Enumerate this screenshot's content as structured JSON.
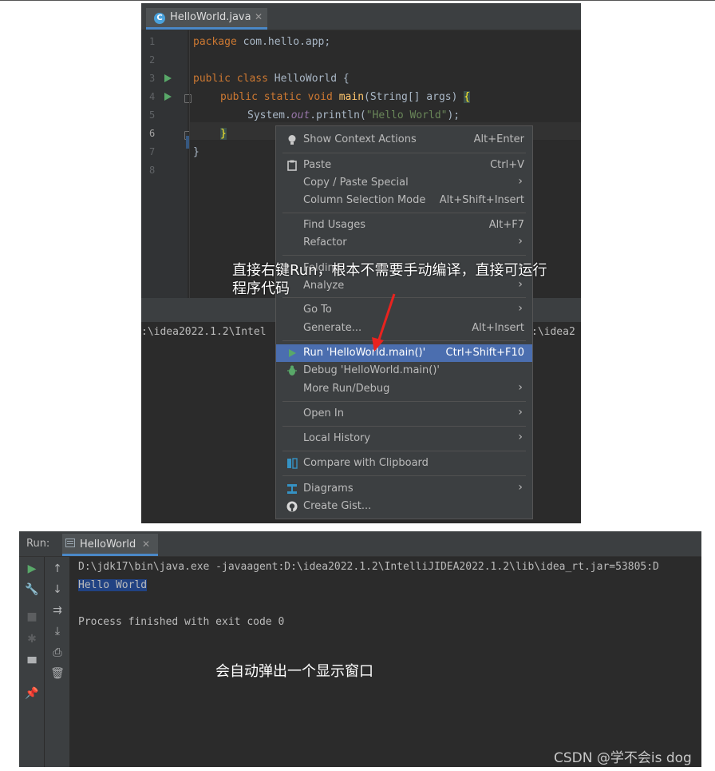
{
  "editor": {
    "tab_title": "HelloWorld.java",
    "tab_icon": "java-class-icon",
    "line_numbers": [
      "1",
      "2",
      "3",
      "4",
      "5",
      "6",
      "7",
      "8"
    ],
    "code": {
      "l1_kw": "package",
      "l1_rest": " com.hello.app;",
      "l3_kw": "public class",
      "l3_rest": " HelloWorld {",
      "l4_kw": "public static void",
      "l4_fn": "main",
      "l4_rest": "(String[] args) ",
      "l4_brace": "{",
      "l5_a": "System.",
      "l5_out": "out",
      "l5_b": ".println(",
      "l5_str": "\"Hello World\"",
      "l5_c": ");",
      "l6_brace": "}",
      "l7": "}"
    },
    "console_fragment_left": ":\\idea2022.1.2\\Intel",
    "console_fragment_right": ":\\idea2"
  },
  "context_menu": {
    "items": [
      {
        "label": "Show Context Actions",
        "shortcut": "Alt+Enter",
        "icon": "bulb-icon"
      },
      {
        "label": "Paste",
        "shortcut": "Ctrl+V",
        "icon": "clipboard-icon"
      },
      {
        "label": "Copy / Paste Special",
        "shortcut": "",
        "icon": ""
      },
      {
        "label": "Column Selection Mode",
        "shortcut": "Alt+Shift+Insert",
        "icon": ""
      },
      {
        "label": "Find Usages",
        "shortcut": "Alt+F7",
        "icon": ""
      },
      {
        "label": "Refactor",
        "shortcut": "",
        "icon": ""
      },
      {
        "label": "Folding",
        "shortcut": "",
        "icon": ""
      },
      {
        "label": "Analyze",
        "shortcut": "",
        "icon": ""
      },
      {
        "label": "Go To",
        "shortcut": "",
        "icon": ""
      },
      {
        "label": "Generate...",
        "shortcut": "Alt+Insert",
        "icon": ""
      },
      {
        "label": "Run 'HelloWorld.main()'",
        "shortcut": "Ctrl+Shift+F10",
        "icon": "run-icon"
      },
      {
        "label": "Debug 'HelloWorld.main()'",
        "shortcut": "",
        "icon": "debug-icon"
      },
      {
        "label": "More Run/Debug",
        "shortcut": "",
        "icon": ""
      },
      {
        "label": "Open In",
        "shortcut": "",
        "icon": ""
      },
      {
        "label": "Local History",
        "shortcut": "",
        "icon": ""
      },
      {
        "label": "Compare with Clipboard",
        "shortcut": "",
        "icon": "compare-icon"
      },
      {
        "label": "Diagrams",
        "shortcut": "",
        "icon": "diagram-icon"
      },
      {
        "label": "Create Gist...",
        "shortcut": "",
        "icon": "github-icon"
      }
    ]
  },
  "annotation_top": "直接右键Run，根本不需要手动编译，直接可运行程序代码",
  "annotation_top_line1": "直接右键Run，根本不需要手动编译，直接可运行",
  "annotation_top_line2": "程序代码",
  "run_panel": {
    "label": "Run:",
    "tab_title": "HelloWorld",
    "console_lines": [
      "D:\\jdk17\\bin\\java.exe -javaagent:D:\\idea2022.1.2\\IntelliJIDEA2022.1.2\\lib\\idea_rt.jar=53805:D",
      "Hello World",
      "",
      "Process finished with exit code 0"
    ],
    "annotation": "会自动弹出一个显示窗口"
  },
  "watermark": "CSDN @学不会is dog",
  "colors": {
    "editor_bg": "#2b2b2b",
    "menu_bg": "#3c3f41",
    "selection": "#4b6eaf",
    "keyword": "#cc7832",
    "string": "#6a8759",
    "run_green": "#59a869",
    "arrow_red": "#e8231f"
  }
}
